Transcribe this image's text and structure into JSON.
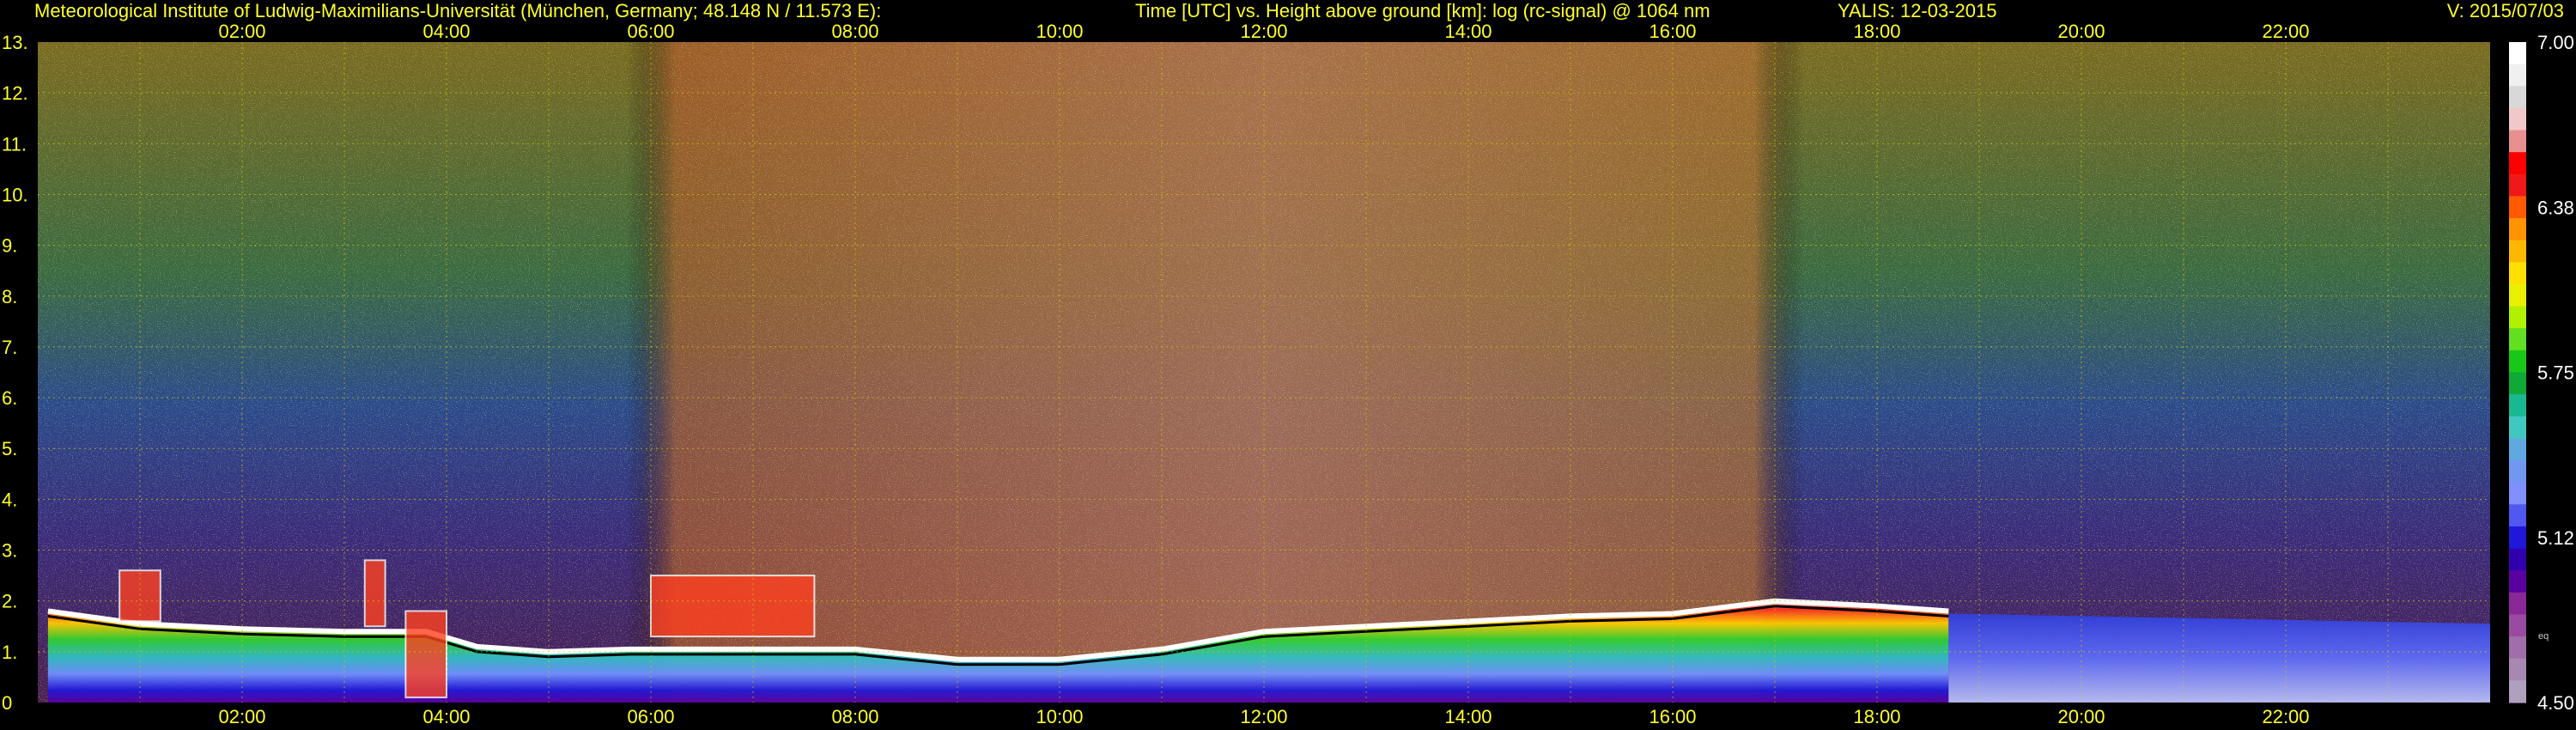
{
  "header": {
    "institute": "Meteorological Institute of Ludwig-Maximilians-Universität (München, Germany; 48.148 N / 11.573 E):",
    "description": "Time [UTC] vs. Height above ground [km]: log (rc-signal) @ 1064 nm",
    "station": "YALIS: 12-03-2015",
    "version": "V: 2015/07/03"
  },
  "colors": {
    "text": "#ffff2a",
    "grid": "#d2c900",
    "background": "#000000"
  },
  "chart_data": {
    "type": "heatmap",
    "title": "Time [UTC] vs. Height above ground [km]: log (rc-signal) @ 1064 nm",
    "x_unit": "hours UTC",
    "xlim": [
      0,
      24
    ],
    "x_ticks": [
      {
        "value": 2,
        "label": "02:00"
      },
      {
        "value": 4,
        "label": "04:00"
      },
      {
        "value": 6,
        "label": "06:00"
      },
      {
        "value": 8,
        "label": "08:00"
      },
      {
        "value": 10,
        "label": "10:00"
      },
      {
        "value": 12,
        "label": "12:00"
      },
      {
        "value": 14,
        "label": "14:00"
      },
      {
        "value": 16,
        "label": "16:00"
      },
      {
        "value": 18,
        "label": "18:00"
      },
      {
        "value": 20,
        "label": "20:00"
      },
      {
        "value": 22,
        "label": "22:00"
      }
    ],
    "ylim": [
      0,
      13
    ],
    "y_ticks": [
      "0",
      "1.",
      "2.",
      "3.",
      "4.",
      "5.",
      "6.",
      "7.",
      "8.",
      "9.",
      "10.",
      "11.",
      "12.",
      "13."
    ],
    "grid": true,
    "colorbar": {
      "range": [
        4.5,
        7.0
      ],
      "tick_labels": [
        "7.00",
        "6.38",
        "5.75",
        "5.12",
        "4.50"
      ],
      "bottom_label": "eq",
      "colors_top_to_bottom": [
        "#ffffff",
        "#f0f0f0",
        "#d8d8d8",
        "#f0c8c8",
        "#e89090",
        "#ff0000",
        "#f01818",
        "#ff5a00",
        "#ff9400",
        "#ffb800",
        "#ffe000",
        "#e8f000",
        "#b0f000",
        "#60e020",
        "#18c818",
        "#10a838",
        "#18b890",
        "#40c8c0",
        "#60a8e0",
        "#7098f0",
        "#8090ff",
        "#5058f0",
        "#2018d8",
        "#3000b0",
        "#5a00a0",
        "#8a2898",
        "#9a4aa0",
        "#a06ea8",
        "#a888b0",
        "#b0a0c0"
      ]
    },
    "boundary_layer_top_km": [
      {
        "t": 0.1,
        "h": 1.8
      },
      {
        "t": 1.0,
        "h": 1.55
      },
      {
        "t": 2.0,
        "h": 1.45
      },
      {
        "t": 3.0,
        "h": 1.4
      },
      {
        "t": 3.8,
        "h": 1.4
      },
      {
        "t": 4.3,
        "h": 1.1
      },
      {
        "t": 5.0,
        "h": 1.0
      },
      {
        "t": 5.8,
        "h": 1.05
      },
      {
        "t": 6.2,
        "h": 1.05
      },
      {
        "t": 7.0,
        "h": 1.05
      },
      {
        "t": 8.0,
        "h": 1.05
      },
      {
        "t": 9.0,
        "h": 0.85
      },
      {
        "t": 10.0,
        "h": 0.85
      },
      {
        "t": 11.0,
        "h": 1.05
      },
      {
        "t": 12.0,
        "h": 1.4
      },
      {
        "t": 13.0,
        "h": 1.5
      },
      {
        "t": 14.0,
        "h": 1.6
      },
      {
        "t": 15.0,
        "h": 1.7
      },
      {
        "t": 16.0,
        "h": 1.75
      },
      {
        "t": 17.0,
        "h": 2.0
      },
      {
        "t": 18.0,
        "h": 1.9
      },
      {
        "t": 18.7,
        "h": 1.8
      }
    ],
    "cloud_patches_km": [
      {
        "t0": 0.8,
        "t1": 1.2,
        "h0": 1.6,
        "h1": 2.6
      },
      {
        "t0": 3.2,
        "t1": 3.4,
        "h0": 1.5,
        "h1": 2.8
      },
      {
        "t0": 3.6,
        "t1": 4.0,
        "h0": 0.1,
        "h1": 1.8
      },
      {
        "t0": 6.0,
        "t1": 7.6,
        "h0": 1.3,
        "h1": 2.5
      }
    ]
  }
}
